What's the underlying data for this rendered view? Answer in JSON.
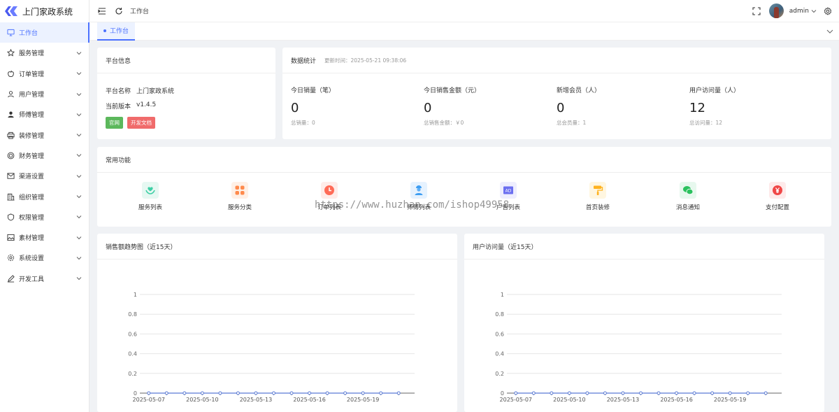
{
  "app": {
    "title": "上门家政系统"
  },
  "sidebar": {
    "items": [
      {
        "label": "工作台",
        "icon": "monitor-icon",
        "active": true
      },
      {
        "label": "服务管理",
        "icon": "star-icon"
      },
      {
        "label": "订单管理",
        "icon": "apple-icon"
      },
      {
        "label": "用户管理",
        "icon": "user-icon"
      },
      {
        "label": "师傅管理",
        "icon": "user-solid-icon"
      },
      {
        "label": "装修管理",
        "icon": "printer-icon"
      },
      {
        "label": "财务管理",
        "icon": "coin-icon"
      },
      {
        "label": "渠道设置",
        "icon": "message-icon"
      },
      {
        "label": "组织管理",
        "icon": "office-icon"
      },
      {
        "label": "权限管理",
        "icon": "lock-icon"
      },
      {
        "label": "素材管理",
        "icon": "picture-icon"
      },
      {
        "label": "系统设置",
        "icon": "gear-icon"
      },
      {
        "label": "开发工具",
        "icon": "pen-icon"
      }
    ]
  },
  "topbar": {
    "breadcrumb": "工作台",
    "username": "admin"
  },
  "tabs": [
    {
      "label": "工作台"
    }
  ],
  "platform": {
    "title": "平台信息",
    "name_label": "平台名称",
    "name_value": "上门家政系统",
    "version_label": "当前版本",
    "version_value": "v1.4.5",
    "btn_site": "官网",
    "btn_docs": "开发文档"
  },
  "stats": {
    "title": "数据统计",
    "update_time": "更新时间：2025-05-21 09:38:06",
    "items": [
      {
        "title": "今日销量（笔）",
        "value": "0",
        "sub": "总销量：0"
      },
      {
        "title": "今日销售金额（元）",
        "value": "0",
        "sub": "总销售金额：￥0"
      },
      {
        "title": "新增会员（人）",
        "value": "0",
        "sub": "总会员量：1"
      },
      {
        "title": "用户访问量（人）",
        "value": "12",
        "sub": "总访问量：12"
      }
    ]
  },
  "functions": {
    "title": "常用功能",
    "items": [
      {
        "label": "服务列表",
        "icon": "heart-hand-icon",
        "color": "#3ecfa5",
        "bg": "#e6f8f2"
      },
      {
        "label": "服务分类",
        "icon": "grid-icon",
        "color": "#ff8a4c",
        "bg": "#fff0e6"
      },
      {
        "label": "订单列表",
        "icon": "clock-icon",
        "color": "#ff6b57",
        "bg": "#ffece9"
      },
      {
        "label": "师傅列表",
        "icon": "worker-icon",
        "color": "#3d9df2",
        "bg": "#e6f2fe"
      },
      {
        "label": "广告列表",
        "icon": "ad-icon",
        "color": "#6b6ff0",
        "bg": "#eeeefe"
      },
      {
        "label": "首页装修",
        "icon": "paint-roller-icon",
        "color": "#ffb21e",
        "bg": "#fff6e0"
      },
      {
        "label": "消息通知",
        "icon": "wechat-icon",
        "color": "#2bc15e",
        "bg": "#e7f8ee"
      },
      {
        "label": "支付配置",
        "icon": "yen-icon",
        "color": "#f04747",
        "bg": "#feeaea"
      }
    ]
  },
  "watermark": "https://www.huzhan.com/ishop49958",
  "colors": {
    "accent": "#4a70ff",
    "line": "#5b7bd5"
  },
  "chart_data": [
    {
      "type": "line",
      "title": "销售额趋势图（近15天）",
      "x": [
        "2025-05-07",
        "2025-05-08",
        "2025-05-09",
        "2025-05-10",
        "2025-05-11",
        "2025-05-12",
        "2025-05-13",
        "2025-05-14",
        "2025-05-15",
        "2025-05-16",
        "2025-05-17",
        "2025-05-18",
        "2025-05-19",
        "2025-05-20",
        "2025-05-21"
      ],
      "x_tick_labels": [
        "2025-05-07",
        "2025-05-10",
        "2025-05-13",
        "2025-05-16",
        "2025-05-19"
      ],
      "series": [
        {
          "values": [
            0,
            0,
            0,
            0,
            0,
            0,
            0,
            0,
            0,
            0,
            0,
            0,
            0,
            0,
            0
          ]
        }
      ],
      "y_ticks": [
        "0",
        "0.2",
        "0.4",
        "0.6",
        "0.8",
        "1"
      ],
      "ylim": [
        0,
        1
      ],
      "grid": true
    },
    {
      "type": "line",
      "title": "用户访问量（近15天）",
      "x": [
        "2025-05-07",
        "2025-05-08",
        "2025-05-09",
        "2025-05-10",
        "2025-05-11",
        "2025-05-12",
        "2025-05-13",
        "2025-05-14",
        "2025-05-15",
        "2025-05-16",
        "2025-05-17",
        "2025-05-18",
        "2025-05-19",
        "2025-05-20",
        "2025-05-21"
      ],
      "x_tick_labels": [
        "2025-05-07",
        "2025-05-10",
        "2025-05-13",
        "2025-05-16",
        "2025-05-19"
      ],
      "series": [
        {
          "values": [
            0,
            0,
            0,
            0,
            0,
            0,
            0,
            0,
            0,
            0,
            0,
            0,
            0,
            0,
            0
          ]
        }
      ],
      "y_ticks": [
        "0",
        "0.2",
        "0.4",
        "0.6",
        "0.8",
        "1"
      ],
      "ylim": [
        0,
        1
      ],
      "grid": true
    }
  ]
}
